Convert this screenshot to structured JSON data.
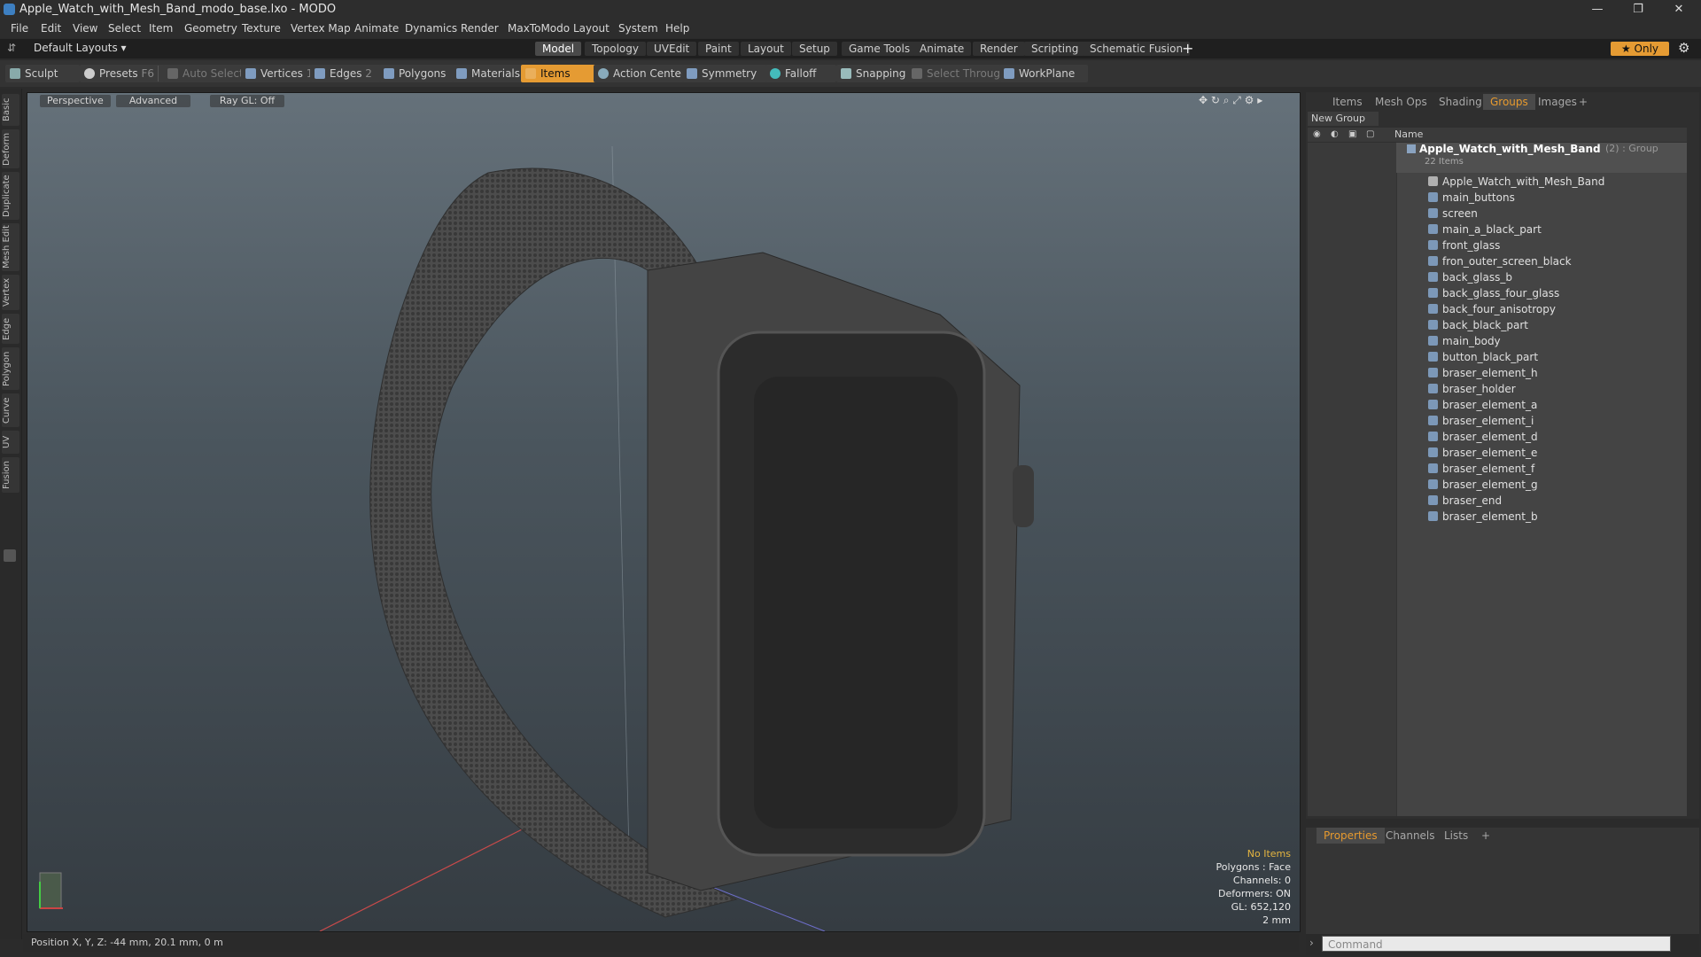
{
  "window": {
    "title": "Apple_Watch_with_Mesh_Band_modo_base.lxo - MODO",
    "minimize": "—",
    "restore": "❐",
    "close": "✕"
  },
  "menu": [
    "File",
    "Edit",
    "View",
    "Select",
    "Item",
    "Geometry",
    "Texture",
    "Vertex Map",
    "Animate",
    "Dynamics",
    "Render",
    "MaxToModo",
    "Layout",
    "System",
    "Help"
  ],
  "layout_row": {
    "layout_selector": "Default Layouts ▾",
    "tabs": [
      "Model",
      "Topology",
      "UVEdit",
      "Paint",
      "Layout",
      "Setup",
      "Game Tools",
      "Animate",
      "Render",
      "Scripting",
      "Schematic Fusion"
    ],
    "add": "+",
    "only": "★  Only",
    "gear": "⚙"
  },
  "toolbar": {
    "sculpt": "Sculpt",
    "presets": "Presets",
    "presets_key": "F6",
    "auto_select": "Auto Select",
    "vertices": "Vertices",
    "vertices_count": "1",
    "edges": "Edges",
    "edges_count": "2",
    "polygons": "Polygons",
    "materials": "Materials",
    "items": "Items",
    "action_center": "Action Center",
    "symmetry": "Symmetry",
    "falloff": "Falloff",
    "snapping": "Snapping",
    "select_through": "Select Through",
    "workplane": "WorkPlane"
  },
  "left_tabs": [
    "Basic",
    "Deform",
    "Duplicate",
    "Mesh Edit",
    "Vertex",
    "Edge",
    "Polygon",
    "Curve",
    "UV",
    "Fusion"
  ],
  "viewport": {
    "view": "Perspective",
    "shading": "Advanced",
    "raygl": "Ray GL: Off",
    "info": {
      "selection": "No Items",
      "polygons": "Polygons : Face",
      "channels": "Channels: 0",
      "deformers": "Deformers: ON",
      "gl": "GL: 652,120",
      "scale": "2 mm"
    }
  },
  "right_panel": {
    "tabs": [
      "Items",
      "Mesh Ops",
      "Shading",
      "Groups",
      "Images"
    ],
    "add": "+",
    "new_group": "New Group",
    "column_name": "Name",
    "group_name": "Apple_Watch_with_Mesh_Band",
    "group_suffix": "(2) : Group",
    "group_count": "22 Items",
    "items": [
      "Apple_Watch_with_Mesh_Band",
      "main_buttons",
      "screen",
      "main_a_black_part",
      "front_glass",
      "fron_outer_screen_black",
      "back_glass_b",
      "back_glass_four_glass",
      "back_four_anisotropy",
      "back_black_part",
      "main_body",
      "button_black_part",
      "braser_element_h",
      "braser_holder",
      "braser_element_a",
      "braser_element_i",
      "braser_element_d",
      "braser_element_e",
      "braser_element_f",
      "braser_element_g",
      "braser_end",
      "braser_element_b"
    ]
  },
  "properties_panel": {
    "tabs": [
      "Properties",
      "Channels",
      "Lists"
    ],
    "add": "+"
  },
  "status": {
    "position": "Position X, Y, Z:  -44 mm, 20.1 mm, 0 m"
  },
  "command": {
    "placeholder": "Command"
  },
  "colors": {
    "accent": "#e59b33",
    "bg": "#2b2b2b"
  }
}
